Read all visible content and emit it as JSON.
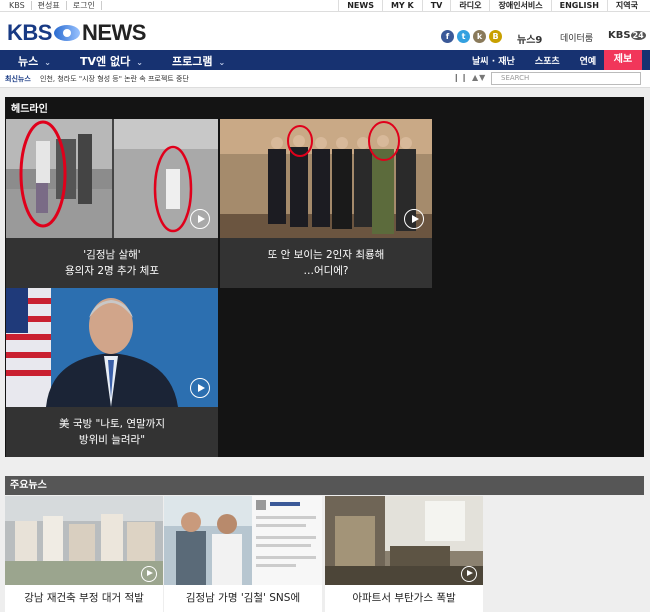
{
  "util": {
    "left": [
      "KBS",
      "편성표",
      "로그인"
    ],
    "right": [
      "NEWS",
      "MY K",
      "TV",
      "라디오",
      "장애인서비스",
      "ENGLISH",
      "지역국"
    ]
  },
  "header": {
    "logo_kbs": "KBS",
    "logo_news": "NEWS",
    "social": [
      "f",
      "t",
      "k",
      "B"
    ],
    "news9": "뉴스9",
    "data_link": "데이터룸",
    "kbs24": "KBS",
    "kbs24_badge": "24"
  },
  "nav": {
    "items": [
      "뉴스",
      "TV엔 없다",
      "프로그램"
    ],
    "right": [
      "날씨 · 재난",
      "스포츠",
      "연예"
    ],
    "report": "제보",
    "chevron": "⌄"
  },
  "ticker": {
    "label": "최신뉴스",
    "text": "인천, 청라도 \"시장 형성 등\" 논란 속 프로젝트 중단",
    "controls": "❙❙ ▲▼",
    "search_placeholder": "SEARCH"
  },
  "headline": {
    "title": "헤드라인",
    "cards": [
      {
        "caption_line1": "'김정남 살해'",
        "caption_line2": "용의자 2명 추가 체포"
      },
      {
        "caption_line1": "또 안 보이는 2인자 최룡해",
        "caption_line2": "…어디에?"
      },
      {
        "caption_line1": "美 국방 \"나토, 연말까지",
        "caption_line2": "방위비 늘려라\""
      }
    ]
  },
  "main_news": {
    "title": "주요뉴스",
    "cards": [
      {
        "caption": "강남 재건축 부정 대거 적발"
      },
      {
        "caption": "김정남 가명 '김철' SNS에"
      },
      {
        "caption": "아파트서 부탄가스 폭발"
      }
    ]
  },
  "colors": {
    "nav_bg": "#173271",
    "report_bg": "#f1365a",
    "headline_bg": "#141414"
  }
}
